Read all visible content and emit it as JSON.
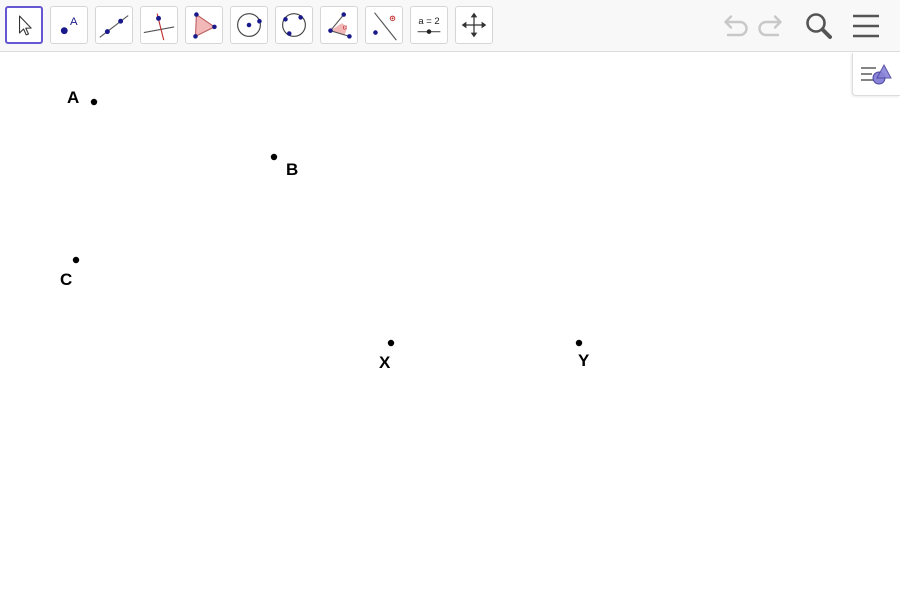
{
  "toolbar": {
    "tools": [
      {
        "name": "move-tool",
        "icon": "cursor-arrow-icon",
        "selected": true
      },
      {
        "name": "point-tool",
        "icon": "point-icon",
        "icon_letter": "A"
      },
      {
        "name": "line-tool",
        "icon": "line-through-two-points-icon"
      },
      {
        "name": "perpendicular-line-tool",
        "icon": "perpendicular-line-icon"
      },
      {
        "name": "polygon-tool",
        "icon": "polygon-icon"
      },
      {
        "name": "circle-center-point-tool",
        "icon": "circle-center-point-icon"
      },
      {
        "name": "circle-three-points-tool",
        "icon": "circle-three-points-icon"
      },
      {
        "name": "angle-tool",
        "icon": "angle-icon",
        "icon_letter": "α"
      },
      {
        "name": "reflect-about-line-tool",
        "icon": "reflect-about-line-icon"
      },
      {
        "name": "slider-tool",
        "icon": "slider-icon",
        "icon_text": "a = 2"
      },
      {
        "name": "move-graphics-view-tool",
        "icon": "move-graphics-view-icon"
      }
    ],
    "undo_icon": "undo-icon",
    "redo_icon": "redo-icon",
    "search_icon": "search-icon",
    "menu_icon": "menu-icon"
  },
  "style_bar_toggle": {
    "icon": "style-bar-icon"
  },
  "points": [
    {
      "label": "A"
    },
    {
      "label": "B"
    },
    {
      "label": "C"
    },
    {
      "label": "X"
    },
    {
      "label": "Y"
    }
  ],
  "colors": {
    "accent": "#6557d2",
    "point_blue": "#1a1a8c",
    "polygon_fill": "#f2b8b8",
    "polygon_stroke": "#c06060",
    "disabled_gray": "#c8c8c8",
    "icon_dark": "#555555"
  }
}
